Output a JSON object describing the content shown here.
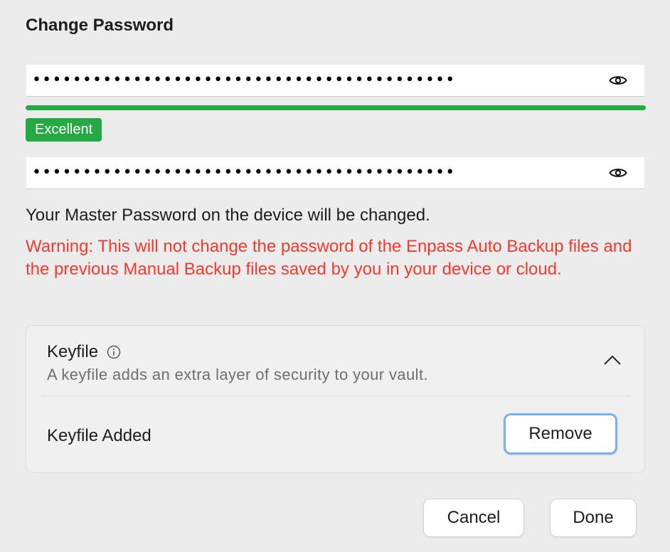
{
  "dialog": {
    "title": "Change Password"
  },
  "new_password": {
    "masked_value": "••••••••••••••••••••••••••••••••••••••••••",
    "show_icon": "eye-icon"
  },
  "strength": {
    "level_fraction": 1.0,
    "label": "Excellent",
    "color": "#26a844"
  },
  "confirm_password": {
    "masked_value": "••••••••••••••••••••••••••••••••••••••••••",
    "show_icon": "eye-icon"
  },
  "messages": {
    "info": "Your Master Password on the device will be changed.",
    "warning": "Warning: This will not change the password of the Enpass Auto Backup files and the previous Manual Backup files saved by you in your device or cloud.",
    "warning_color": "#f03a2e"
  },
  "keyfile": {
    "title": "Keyfile",
    "info_icon": "info-icon",
    "description": "A keyfile adds an extra layer of security to your vault.",
    "collapse_icon": "chevron-up-icon",
    "status": "Keyfile Added",
    "remove_label": "Remove"
  },
  "footer": {
    "cancel_label": "Cancel",
    "done_label": "Done"
  }
}
